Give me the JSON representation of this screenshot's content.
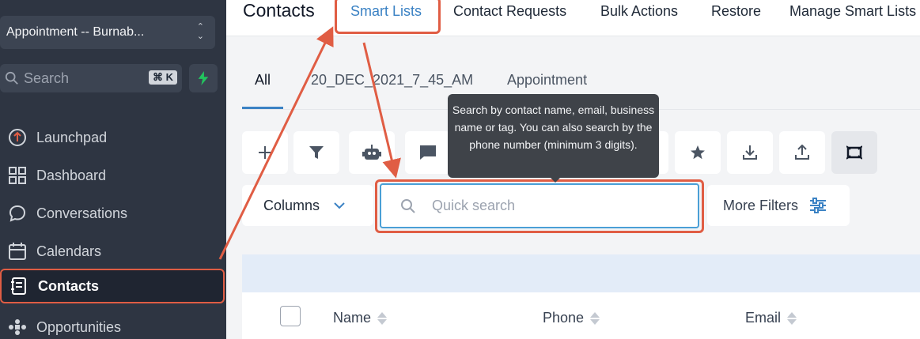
{
  "sidebar": {
    "location": "Appointment -- Burnab...",
    "search_placeholder": "Search",
    "search_shortcut": "⌘ K",
    "items": [
      {
        "label": "Launchpad",
        "icon": "launchpad-icon"
      },
      {
        "label": "Dashboard",
        "icon": "dashboard-icon"
      },
      {
        "label": "Conversations",
        "icon": "chat-bubble-icon"
      },
      {
        "label": "Calendars",
        "icon": "calendar-icon"
      },
      {
        "label": "Contacts",
        "icon": "contacts-book-icon",
        "active": true
      },
      {
        "label": "Opportunities",
        "icon": "opportunities-icon"
      }
    ]
  },
  "header": {
    "title": "Contacts",
    "tabs": [
      "Smart Lists",
      "Contact Requests",
      "Bulk Actions",
      "Restore",
      "Manage Smart Lists"
    ],
    "active_tab": "Smart Lists"
  },
  "subtabs": [
    "All",
    "20_DEC_2021_7_45_AM",
    "Appointment"
  ],
  "active_subtab": "All",
  "toolbar": {
    "icons": [
      "add-icon",
      "filter-icon",
      "robot-icon",
      "message-icon",
      "email-icon",
      "tag-icon",
      "remove-tag-icon",
      "delete-icon",
      "star-icon",
      "download-icon",
      "upload-icon",
      "merge-icon"
    ]
  },
  "tooltip": {
    "text": "Search by contact name, email, business name or tag. You can also search by the phone number (minimum 3 digits)."
  },
  "filters": {
    "columns_label": "Columns",
    "search_placeholder": "Quick search",
    "more_filters_label": "More Filters"
  },
  "table": {
    "columns": [
      "Name",
      "Phone",
      "Email"
    ]
  },
  "colors": {
    "sidebar_bg": "#2e3542",
    "accent": "#3b82c4",
    "annotation": "#e05d44"
  }
}
